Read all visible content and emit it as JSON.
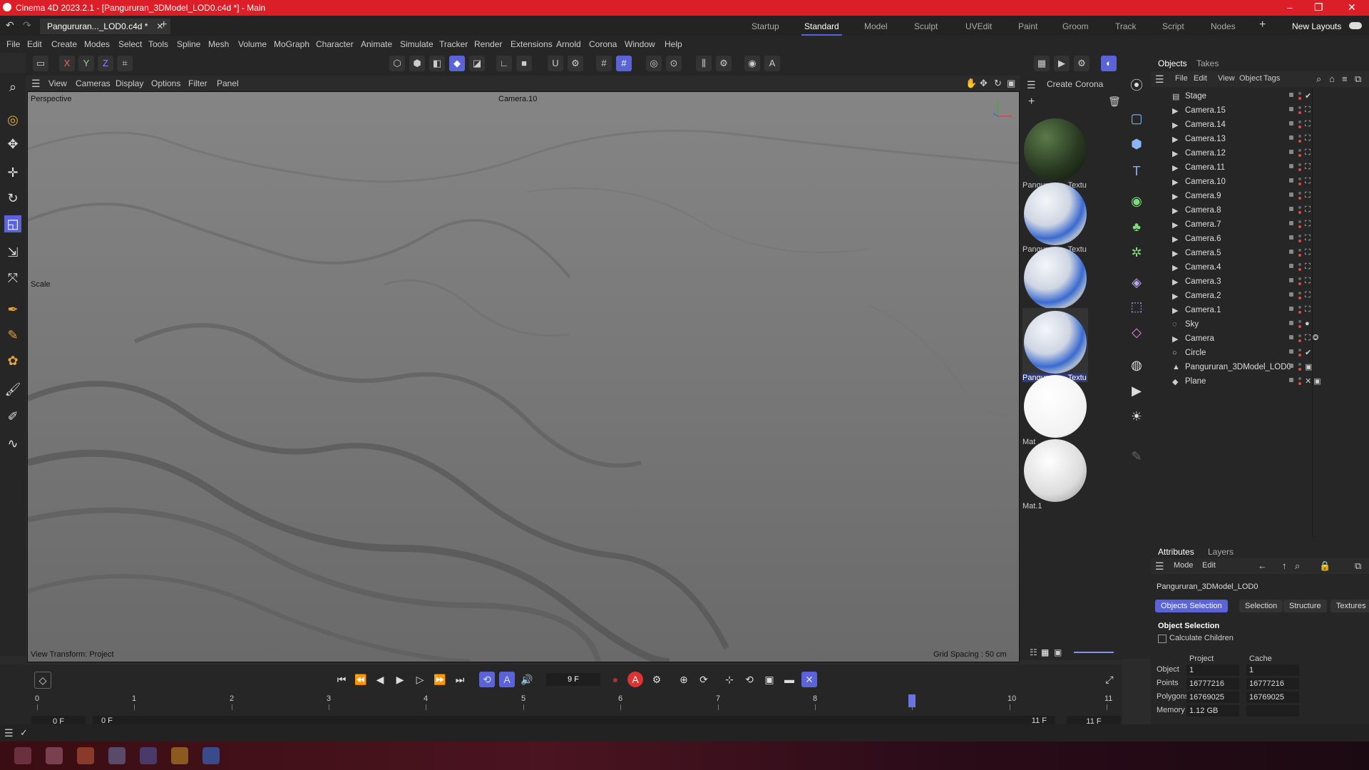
{
  "window": {
    "title": "Cinema 4D 2023.2.1 - [Pangururan_3DModel_LOD0.c4d *] - Main"
  },
  "doc_tab": {
    "label": "Pangururan..._LOD0.c4d *"
  },
  "layouts": [
    "Startup",
    "Standard",
    "Model",
    "Sculpt",
    "UVEdit",
    "Paint",
    "Groom",
    "Track",
    "Script",
    "Nodes"
  ],
  "layout_active": "Standard",
  "new_layouts": "New Layouts",
  "menu": [
    "File",
    "Edit",
    "Create",
    "Modes",
    "Select",
    "Tools",
    "Spline",
    "Mesh",
    "Volume",
    "MoGraph",
    "Character",
    "Animate",
    "Simulate",
    "Tracker",
    "Render",
    "Extensions",
    "Arnold",
    "Corona",
    "Window",
    "Help"
  ],
  "axes": {
    "x": "X",
    "y": "Y",
    "z": "Z"
  },
  "viewport": {
    "menu": [
      "View",
      "Cameras",
      "Display",
      "Options",
      "Filter",
      "Panel"
    ],
    "name": "Perspective",
    "camera": "Camera.10",
    "tool_label": "Scale",
    "view_transform": "View Transform: Project",
    "grid_spacing": "Grid Spacing : 50 cm"
  },
  "materials": {
    "menu": [
      "Create",
      "Corona"
    ],
    "items": [
      {
        "name": "Pangururan_Textu",
        "style": "terrain",
        "selected": false
      },
      {
        "name": "Pangururan_Textu",
        "style": "blue-white",
        "selected": false
      },
      {
        "name": "Pangururan_Textu",
        "style": "blue-white",
        "selected": false
      },
      {
        "name": "Pangururan_Textu",
        "style": "blue-white",
        "selected": true
      },
      {
        "name": "Mat",
        "style": "white",
        "selected": false
      },
      {
        "name": "Mat.1",
        "style": "white-grey",
        "selected": false
      }
    ]
  },
  "objects_panel": {
    "tabs": [
      "Objects",
      "Takes"
    ],
    "menu": [
      "File",
      "Edit",
      "View",
      "Object",
      "Tags"
    ],
    "items": [
      {
        "name": "Stage",
        "icon": "stage-icon",
        "tag": "✔"
      },
      {
        "name": "Camera.15",
        "icon": "camera-icon",
        "tag": "⛶"
      },
      {
        "name": "Camera.14",
        "icon": "camera-icon",
        "tag": "⛶"
      },
      {
        "name": "Camera.13",
        "icon": "camera-icon",
        "tag": "⛶"
      },
      {
        "name": "Camera.12",
        "icon": "camera-icon",
        "tag": "⛶"
      },
      {
        "name": "Camera.11",
        "icon": "camera-icon",
        "tag": "⛶"
      },
      {
        "name": "Camera.10",
        "icon": "camera-icon",
        "tag": "⛶"
      },
      {
        "name": "Camera.9",
        "icon": "camera-icon",
        "tag": "⛶"
      },
      {
        "name": "Camera.8",
        "icon": "camera-icon",
        "tag": "⛶"
      },
      {
        "name": "Camera.7",
        "icon": "camera-icon",
        "tag": "⛶"
      },
      {
        "name": "Camera.6",
        "icon": "camera-icon",
        "tag": "⛶"
      },
      {
        "name": "Camera.5",
        "icon": "camera-icon",
        "tag": "⛶"
      },
      {
        "name": "Camera.4",
        "icon": "camera-icon",
        "tag": "⛶"
      },
      {
        "name": "Camera.3",
        "icon": "camera-icon",
        "tag": "⛶"
      },
      {
        "name": "Camera.2",
        "icon": "camera-icon",
        "tag": "⛶"
      },
      {
        "name": "Camera.1",
        "icon": "camera-icon",
        "tag": "⛶"
      },
      {
        "name": "Sky",
        "icon": "sky-icon",
        "tag": "●"
      },
      {
        "name": "Camera",
        "icon": "camera-icon",
        "tag": "⛶ ◎"
      },
      {
        "name": "Circle",
        "icon": "circle-icon",
        "tag": "✔"
      },
      {
        "name": "Pangururan_3DModel_LOD0",
        "icon": "polygon-icon",
        "tag": "▣"
      },
      {
        "name": "Plane",
        "icon": "plane-icon",
        "tag": "✕ ▣"
      }
    ]
  },
  "attributes": {
    "tabs": [
      "Attributes",
      "Layers"
    ],
    "menu": [
      "Mode",
      "Edit"
    ],
    "object_name": "Pangururan_3DModel_LOD0",
    "buttons": [
      "Objects Selection",
      "Selection",
      "Structure",
      "Textures"
    ],
    "section": "Object Selection",
    "calc_children": "Calculate Children",
    "col_project": "Project",
    "col_cache": "Cache",
    "rows": [
      {
        "label": "Object",
        "project": "1",
        "cache": "1"
      },
      {
        "label": "Points",
        "project": "16777216",
        "cache": "16777216"
      },
      {
        "label": "Polygons",
        "project": "16769025",
        "cache": "16769025"
      },
      {
        "label": "Memory",
        "project": "1.12 GB",
        "cache": ""
      }
    ]
  },
  "timeline": {
    "current_frame": "9 F",
    "ticks": [
      "0",
      "1",
      "2",
      "3",
      "4",
      "5",
      "6",
      "7",
      "8",
      "9",
      "10",
      "11"
    ],
    "playhead_frame": 9,
    "start_a": "0 F",
    "start_b": "0 F",
    "end_a": "11 F",
    "end_b": "11 F"
  }
}
